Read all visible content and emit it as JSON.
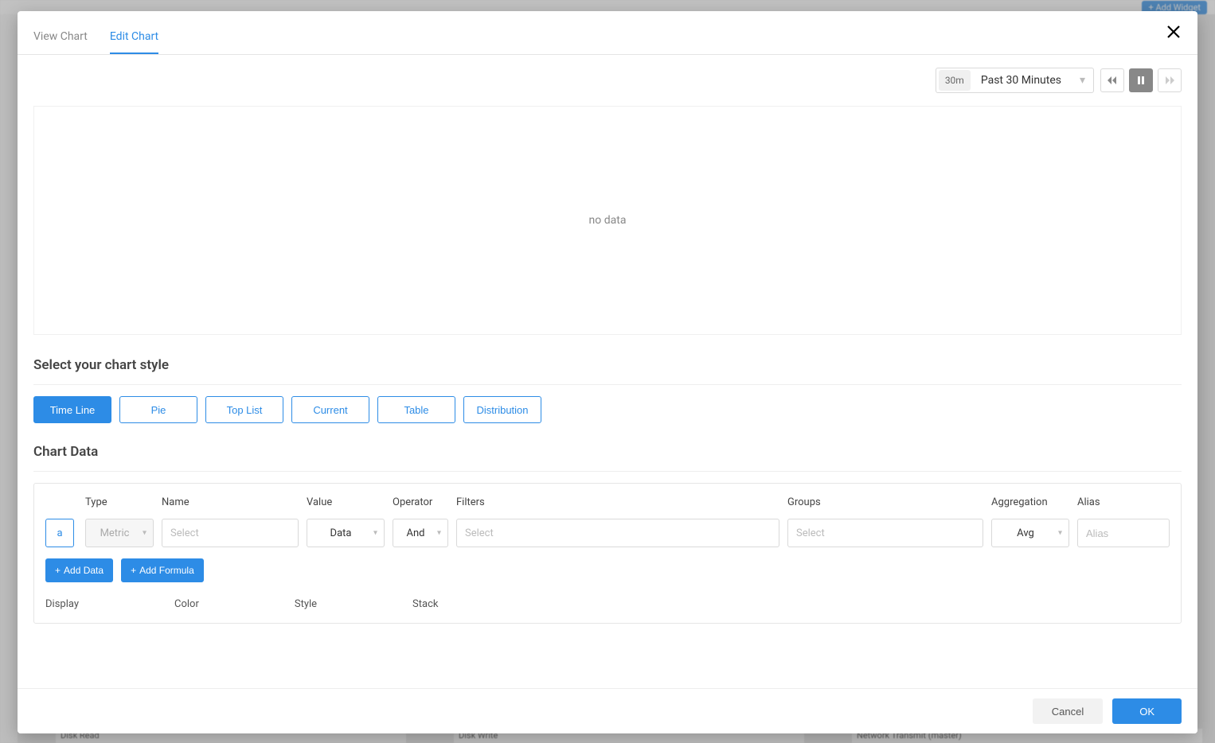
{
  "background": {
    "add_widget": "+ Add Widget",
    "bottom_cards": [
      "Disk Read",
      "Disk Write",
      "Network Transmit (master)"
    ]
  },
  "modal": {
    "tabs": {
      "view": "View Chart",
      "edit": "Edit Chart"
    },
    "time": {
      "badge": "30m",
      "label": "Past 30 Minutes"
    },
    "chart_placeholder": "no data",
    "style_section_title": "Select your chart style",
    "style_buttons": [
      "Time Line",
      "Pie",
      "Top List",
      "Current",
      "Table",
      "Distribution"
    ],
    "chart_data_title": "Chart Data",
    "columns": {
      "type": "Type",
      "name": "Name",
      "value": "Value",
      "operator": "Operator",
      "filters": "Filters",
      "groups": "Groups",
      "aggregation": "Aggregation",
      "alias": "Alias"
    },
    "row": {
      "key": "a",
      "type_value": "Metric",
      "name_placeholder": "Select",
      "value_value": "Data",
      "operator_value": "And",
      "filters_placeholder": "Select",
      "groups_placeholder": "Select",
      "agg_value": "Avg",
      "alias_placeholder": "Alias"
    },
    "add_data": "Add Data",
    "add_formula": "Add Formula",
    "display_labels": {
      "display": "Display",
      "color": "Color",
      "style": "Style",
      "stack": "Stack"
    },
    "footer": {
      "cancel": "Cancel",
      "ok": "OK"
    }
  }
}
